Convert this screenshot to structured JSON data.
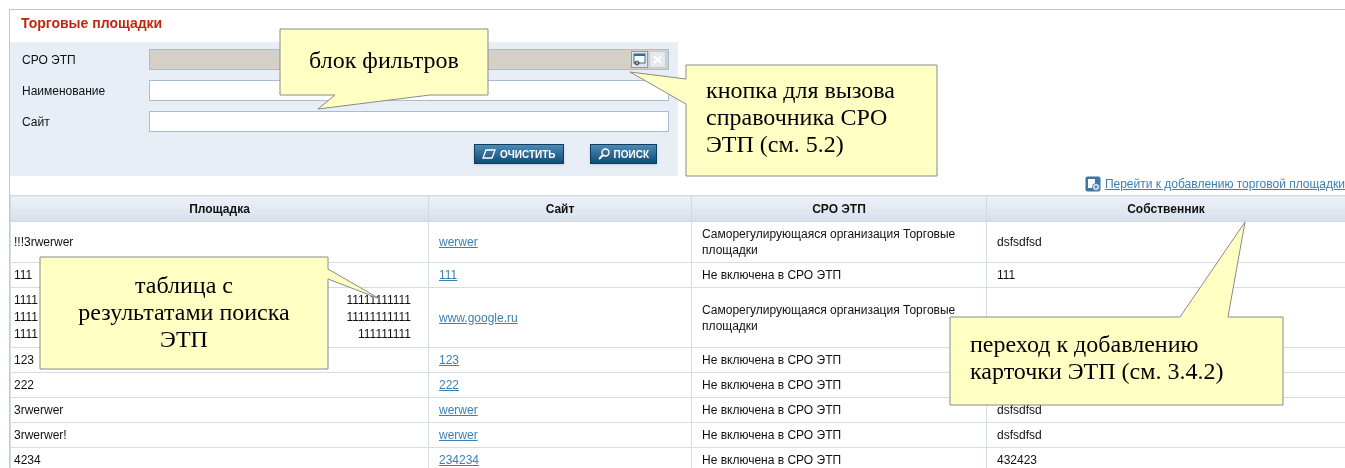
{
  "page": {
    "title": "Торговые площадки"
  },
  "filters": [
    {
      "label": "СРО ЭТП",
      "kind": "lookup"
    },
    {
      "label": "Наименование",
      "kind": "text"
    },
    {
      "label": "Сайт",
      "kind": "text"
    }
  ],
  "buttons": [
    {
      "label": "ОЧИСТИТЬ",
      "kind": "clear"
    },
    {
      "label": "ПОИСК",
      "kind": "search"
    }
  ],
  "add_link": "Перейти к добавлению торговой площадки",
  "table": {
    "columns": [
      "Площадка",
      "Сайт",
      "СРО ЭТП",
      "Собственник"
    ],
    "rows": [
      {
        "place": "!!!3rwerwer",
        "site": "werwer",
        "sro": "Саморегулирующаяся организация Торговые площадки",
        "owner": "dsfsdfsd"
      },
      {
        "place": "111",
        "site": "111",
        "sro": "Не включена в СРО ЭТП",
        "owner": "111"
      },
      {
        "place_lines": [
          [
            "1111",
            "11111111111"
          ],
          [
            "1111",
            "11111111111"
          ],
          [
            "1111",
            "111111111"
          ]
        ],
        "site": "www.google.ru",
        "sro": "Саморегулирующаяся организация Торговые площадки"
      },
      {
        "place": "123",
        "site": "123",
        "sro": "Не включена в СРО ЭТП"
      },
      {
        "place": "222",
        "site": "222",
        "sro": "Не включена в СРО ЭТП"
      },
      {
        "place": "3rwerwer",
        "site": "werwer",
        "sro": "Не включена в СРО ЭТП",
        "owner": "dsfsdfsd"
      },
      {
        "place": "3rwerwer!",
        "site": "werwer",
        "sro": "Не включена в СРО ЭТП",
        "owner": "dsfsdfsd"
      },
      {
        "place": "4234",
        "site": "234234",
        "sro": "Не включена в СРО ЭТП",
        "owner": "432423"
      }
    ]
  },
  "callouts": [
    {
      "text": "блок фильтров"
    },
    {
      "text": "кнопка для вызова справочника СРО ЭТП (см. 5.2)"
    },
    {
      "text": "таблица с результатами поиска ЭТП"
    },
    {
      "text": "переход к добавлению карточки ЭТП (см. 3.4.2)"
    }
  ]
}
